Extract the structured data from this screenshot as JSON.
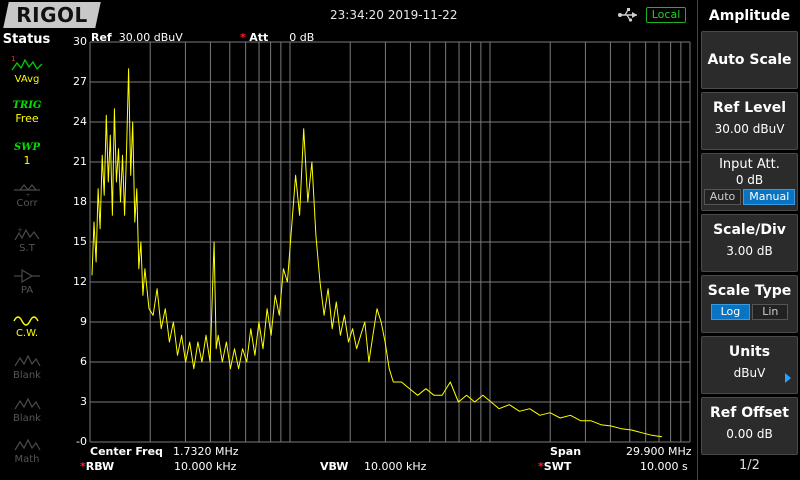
{
  "brand": "RIGOL",
  "datetime": "23:34:20 2019-11-22",
  "remote_badge": "Local",
  "status_panel": {
    "title": "Status",
    "items": [
      {
        "label": "VAvg",
        "icon": "trace-avg-icon"
      },
      {
        "trig": "TRIG",
        "value": "Free"
      },
      {
        "trig": "SWP",
        "value": "1"
      },
      {
        "label": "Corr",
        "icon": "corr-icon"
      },
      {
        "label": "S.T",
        "icon": "st-icon"
      },
      {
        "label": "PA",
        "icon": "pa-icon"
      },
      {
        "label": "C.W.",
        "icon": "cw-icon"
      },
      {
        "label": "Blank",
        "icon": "blank-icon"
      },
      {
        "label": "Blank",
        "icon": "blank-icon"
      },
      {
        "label": "Math",
        "icon": "math-icon"
      }
    ]
  },
  "header": {
    "ref_prefix": "Ref",
    "ref_value": "30.00 dBuV",
    "att_label": "Att",
    "att_value": "0 dB"
  },
  "footer": {
    "center_freq_label": "Center Freq",
    "center_freq_value": "1.7320 MHz",
    "span_label": "Span",
    "span_value": "29.900 MHz",
    "rbw_label": "RBW",
    "rbw_value": "10.000 kHz",
    "vbw_label": "VBW",
    "vbw_value": "10.000 kHz",
    "swt_label": "SWT",
    "swt_value": "10.000 s"
  },
  "menu": {
    "title": "Amplitude",
    "auto_scale": "Auto Scale",
    "ref_level_label": "Ref Level",
    "ref_level_value": "30.00 dBuV",
    "input_att_label": "Input Att.",
    "input_att_value": "0 dB",
    "input_att_auto": "Auto",
    "input_att_manual": "Manual",
    "scale_div_label": "Scale/Div",
    "scale_div_value": "3.00 dB",
    "scale_type_label": "Scale Type",
    "scale_type_log": "Log",
    "scale_type_lin": "Lin",
    "units_label": "Units",
    "units_value": "dBuV",
    "ref_offset_label": "Ref Offset",
    "ref_offset_value": "0.00 dB",
    "page": "1/2"
  },
  "colors": {
    "trace": "#ffff00",
    "grid": "#7a7a7a",
    "accent_blue": "#0a74c4",
    "marker_red": "#ff2020"
  },
  "chart_data": {
    "type": "line",
    "ylim": [
      0,
      30
    ],
    "yticks": [
      "30",
      "27",
      "24",
      "21",
      "18",
      "15",
      "12",
      "9",
      "6",
      "3",
      "-0"
    ],
    "x_scale": "log",
    "grid": true,
    "series": [
      {
        "values": [
          [
            0.0,
            12.5
          ],
          [
            0.01,
            16.5
          ],
          [
            0.02,
            13.5
          ],
          [
            0.03,
            19.0
          ],
          [
            0.04,
            16.0
          ],
          [
            0.05,
            21.5
          ],
          [
            0.06,
            18.5
          ],
          [
            0.07,
            24.5
          ],
          [
            0.08,
            19.5
          ],
          [
            0.09,
            23.0
          ],
          [
            0.1,
            17.0
          ],
          [
            0.11,
            25.0
          ],
          [
            0.12,
            19.5
          ],
          [
            0.13,
            22.0
          ],
          [
            0.14,
            18.0
          ],
          [
            0.15,
            21.5
          ],
          [
            0.16,
            17.0
          ],
          [
            0.17,
            22.0
          ],
          [
            0.18,
            28.0
          ],
          [
            0.19,
            20.0
          ],
          [
            0.2,
            24.0
          ],
          [
            0.21,
            16.5
          ],
          [
            0.22,
            19.0
          ],
          [
            0.23,
            13.0
          ],
          [
            0.24,
            15.0
          ],
          [
            0.25,
            11.0
          ],
          [
            0.26,
            13.0
          ],
          [
            0.28,
            10.0
          ],
          [
            0.3,
            9.5
          ],
          [
            0.32,
            11.5
          ],
          [
            0.34,
            8.5
          ],
          [
            0.36,
            10.0
          ],
          [
            0.38,
            7.5
          ],
          [
            0.4,
            9.0
          ],
          [
            0.42,
            6.5
          ],
          [
            0.44,
            8.0
          ],
          [
            0.46,
            6.0
          ],
          [
            0.48,
            7.5
          ],
          [
            0.5,
            5.5
          ],
          [
            0.52,
            7.5
          ],
          [
            0.54,
            6.0
          ],
          [
            0.56,
            8.0
          ],
          [
            0.58,
            6.0
          ],
          [
            0.6,
            15.0
          ],
          [
            0.61,
            7.0
          ],
          [
            0.62,
            8.0
          ],
          [
            0.64,
            6.0
          ],
          [
            0.66,
            7.5
          ],
          [
            0.68,
            5.5
          ],
          [
            0.7,
            7.0
          ],
          [
            0.72,
            5.5
          ],
          [
            0.74,
            7.0
          ],
          [
            0.76,
            6.0
          ],
          [
            0.78,
            8.5
          ],
          [
            0.8,
            6.5
          ],
          [
            0.82,
            9.0
          ],
          [
            0.84,
            7.0
          ],
          [
            0.86,
            10.0
          ],
          [
            0.88,
            8.0
          ],
          [
            0.9,
            11.0
          ],
          [
            0.92,
            9.5
          ],
          [
            0.94,
            13.0
          ],
          [
            0.96,
            12.0
          ],
          [
            0.98,
            16.0
          ],
          [
            1.0,
            20.0
          ],
          [
            1.02,
            17.0
          ],
          [
            1.04,
            23.5
          ],
          [
            1.06,
            18.0
          ],
          [
            1.08,
            21.0
          ],
          [
            1.1,
            15.5
          ],
          [
            1.12,
            12.0
          ],
          [
            1.14,
            9.5
          ],
          [
            1.16,
            11.5
          ],
          [
            1.18,
            8.5
          ],
          [
            1.2,
            10.5
          ],
          [
            1.22,
            8.0
          ],
          [
            1.24,
            9.5
          ],
          [
            1.26,
            7.5
          ],
          [
            1.28,
            8.5
          ],
          [
            1.3,
            7.0
          ],
          [
            1.32,
            8.0
          ],
          [
            1.34,
            9.0
          ],
          [
            1.36,
            6.0
          ],
          [
            1.38,
            8.0
          ],
          [
            1.4,
            10.0
          ],
          [
            1.42,
            9.0
          ],
          [
            1.44,
            7.5
          ],
          [
            1.46,
            5.5
          ],
          [
            1.48,
            4.5
          ],
          [
            1.52,
            4.5
          ],
          [
            1.56,
            4.0
          ],
          [
            1.6,
            3.5
          ],
          [
            1.64,
            4.0
          ],
          [
            1.68,
            3.5
          ],
          [
            1.72,
            3.5
          ],
          [
            1.76,
            4.5
          ],
          [
            1.8,
            3.0
          ],
          [
            1.84,
            3.5
          ],
          [
            1.88,
            3.0
          ],
          [
            1.92,
            3.5
          ],
          [
            1.96,
            3.0
          ],
          [
            2.0,
            2.5
          ],
          [
            2.05,
            2.8
          ],
          [
            2.1,
            2.3
          ],
          [
            2.15,
            2.5
          ],
          [
            2.2,
            2.0
          ],
          [
            2.25,
            2.2
          ],
          [
            2.3,
            1.8
          ],
          [
            2.35,
            2.0
          ],
          [
            2.4,
            1.6
          ],
          [
            2.45,
            1.6
          ],
          [
            2.5,
            1.3
          ],
          [
            2.55,
            1.2
          ],
          [
            2.6,
            1.0
          ],
          [
            2.65,
            0.9
          ],
          [
            2.7,
            0.7
          ],
          [
            2.75,
            0.5
          ],
          [
            2.8,
            0.4
          ]
        ]
      }
    ]
  }
}
